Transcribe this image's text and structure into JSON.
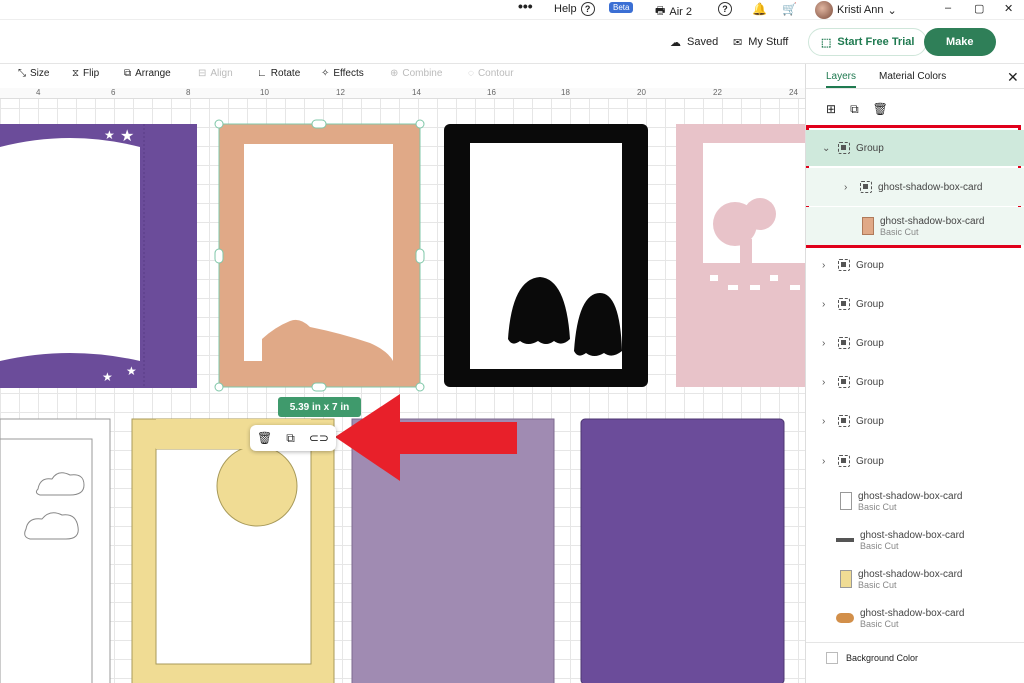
{
  "topbar": {
    "menu_icon": "more-dots-icon",
    "help": "Help",
    "beta": "Beta",
    "machine": "Air 2",
    "user": "Kristi Ann"
  },
  "actionbar": {
    "saved": "Saved",
    "my_stuff": "My Stuff",
    "trial": "Start Free Trial",
    "make": "Make"
  },
  "toolbar": {
    "size": "Size",
    "flip": "Flip",
    "arrange": "Arrange",
    "align": "Align",
    "rotate": "Rotate",
    "effects": "Effects",
    "combine": "Combine",
    "contour": "Contour"
  },
  "ruler": [
    "4",
    "6",
    "8",
    "10",
    "12",
    "14",
    "16",
    "18",
    "20",
    "22",
    "24"
  ],
  "panel": {
    "tabs": [
      "Layers",
      "Material Colors"
    ],
    "rows": [
      {
        "name": "Group",
        "expanded": true
      },
      {
        "name": "ghost-shadow-box-card",
        "child": true
      },
      {
        "name": "ghost-shadow-box-card",
        "sub": "Basic Cut",
        "child": true
      },
      {
        "name": "Group"
      },
      {
        "name": "Group"
      },
      {
        "name": "Group"
      },
      {
        "name": "Group"
      },
      {
        "name": "Group"
      },
      {
        "name": "Group"
      },
      {
        "name": "ghost-shadow-box-card",
        "sub": "Basic Cut"
      },
      {
        "name": "ghost-shadow-box-card",
        "sub": "Basic Cut"
      },
      {
        "name": "ghost-shadow-box-card",
        "sub": "Basic Cut"
      },
      {
        "name": "ghost-shadow-box-card",
        "sub": "Basic Cut"
      }
    ],
    "background_color": "Background Color"
  },
  "canvas": {
    "size_tag": "5.39  in x 7 in"
  },
  "colors": {
    "accent": "#2f7f58",
    "purple": "#6b4c9a",
    "peach": "#e0a987",
    "pink": "#e8c3c9",
    "yellow": "#f0dc94",
    "lilac": "#a08bb2",
    "highlight": "#e0001b"
  }
}
